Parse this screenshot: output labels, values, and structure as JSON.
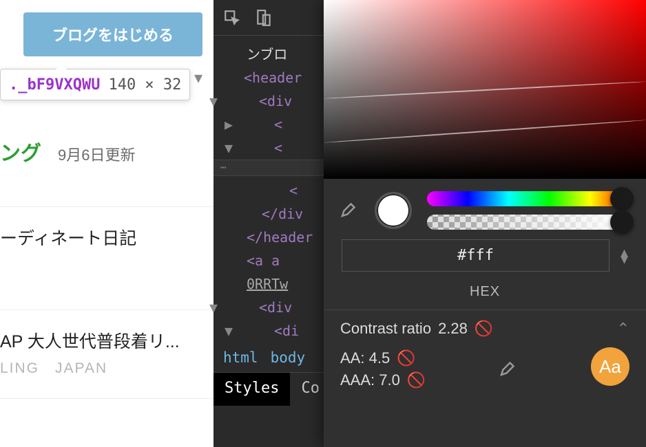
{
  "webpage": {
    "start_blog_button": "ブログをはじめる",
    "tooltip": {
      "class_name": "._bF9VXQWU",
      "dimensions": "140 × 32"
    },
    "ranking_suffix": "ング",
    "ranking_date": "9月6日更新",
    "item1_title": "ーディネート日記",
    "item2_title": "AP 大人世代普段着リ...",
    "item2_subtitle": "LING　JAPAN"
  },
  "devtools": {
    "dom": {
      "line_prefix": "ンブロ",
      "tag_header": "<header",
      "tag_div": "<div",
      "tag_open": "<",
      "close_div": "</div",
      "close_header": "</header",
      "tag_a": "<a a",
      "link_text": "0RRTw",
      "tag_div2": "<div",
      "tag_di": "<di"
    },
    "drag_dots": "⋯",
    "breadcrumbs": [
      "html",
      "body"
    ],
    "tabs": {
      "styles": "Styles",
      "computed": "Co"
    }
  },
  "color_picker": {
    "swatch_color": "#ffffff",
    "hex_value": "#fff",
    "hex_label": "HEX",
    "contrast": {
      "label": "Contrast ratio",
      "value": "2.28",
      "aa_label": "AA:",
      "aa_value": "4.5",
      "aaa_label": "AAA:",
      "aaa_value": "7.0"
    },
    "sample_text": "Aa"
  }
}
